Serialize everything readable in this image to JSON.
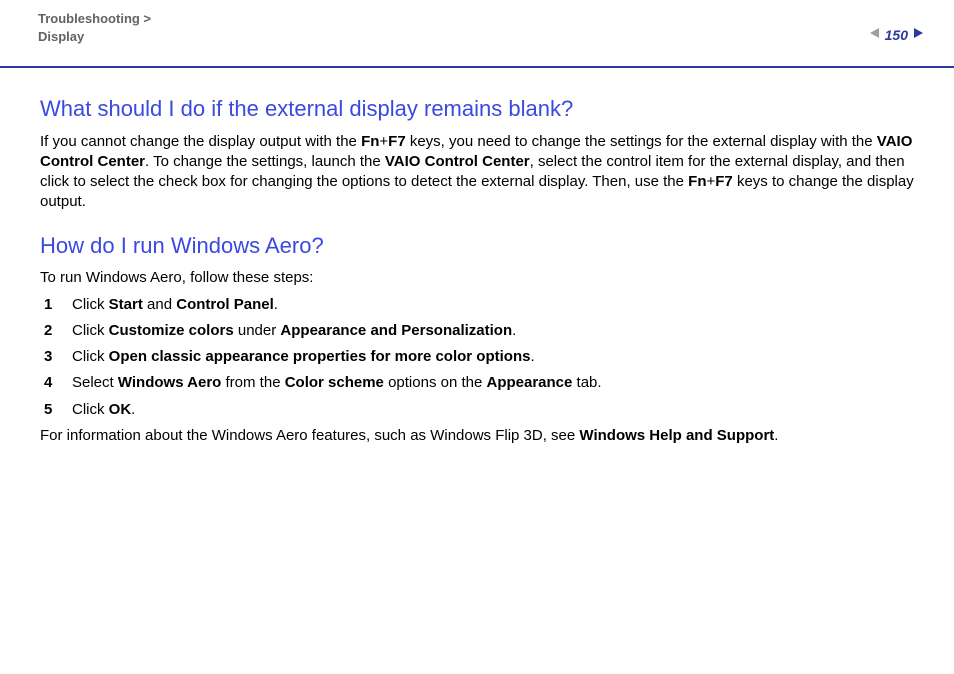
{
  "header": {
    "breadcrumb_top": "Troubleshooting >",
    "breadcrumb_sub": "Display",
    "page_number": "150"
  },
  "section1": {
    "title": "What should I do if the external display remains blank?",
    "para": {
      "t1": "If you cannot change the display output with the ",
      "b1a": "Fn",
      "plus1": "+",
      "b1b": "F7",
      "t2": " keys, you need to change the settings for the external display with the ",
      "b2": "VAIO Control Center",
      "t3": ". To change the settings, launch the ",
      "b3": "VAIO Control Center",
      "t4": ", select the control item for the external display, and then click to select the check box for changing the options to detect the external display. Then, use the ",
      "b4a": "Fn",
      "plus2": "+",
      "b4b": "F7",
      "t5": " keys to change the display output."
    }
  },
  "section2": {
    "title": "How do I run Windows Aero?",
    "intro": "To run Windows Aero, follow these steps:",
    "steps": {
      "s1": {
        "pre": "Click ",
        "b1": "Start",
        "mid": " and ",
        "b2": "Control Panel",
        "post": "."
      },
      "s2": {
        "pre": "Click ",
        "b1": "Customize colors",
        "mid": " under ",
        "b2": "Appearance and Personalization",
        "post": "."
      },
      "s3": {
        "pre": "Click ",
        "b1": "Open classic appearance properties for more color options",
        "post": "."
      },
      "s4": {
        "pre": "Select ",
        "b1": "Windows Aero",
        "mid1": " from the ",
        "b2": "Color scheme",
        "mid2": " options on the ",
        "b3": "Appearance",
        "post": " tab."
      },
      "s5": {
        "pre": "Click ",
        "b1": "OK",
        "post": "."
      }
    },
    "outro": {
      "t1": "For information about the Windows Aero features, such as Windows Flip 3D, see ",
      "b1": "Windows Help and Support",
      "t2": "."
    }
  }
}
